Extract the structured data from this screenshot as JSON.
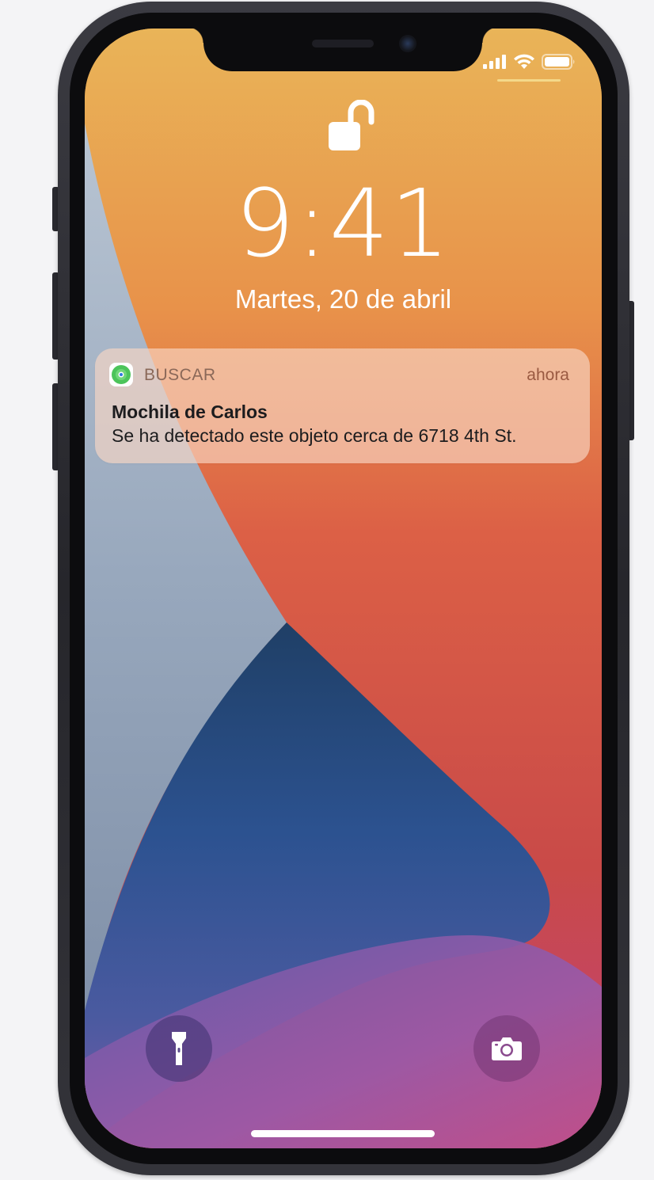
{
  "colors": {
    "wallpaper_orange": "#e8a24a",
    "wallpaper_red": "#d8523f",
    "wallpaper_blue": "#2f4f80",
    "wallpaper_purple": "#8a5aa8",
    "notification_bg": "#f6d4c2",
    "accent_time": "#9a5a42"
  },
  "status_bar": {
    "signal_icon": "cellular-signal-icon",
    "wifi_icon": "wifi-icon",
    "battery_icon": "battery-icon"
  },
  "lock": {
    "icon": "unlocked-padlock-icon"
  },
  "lock_screen": {
    "time": "9:41",
    "date": "Martes, 20 de abril"
  },
  "notification": {
    "app_icon": "find-my-icon",
    "app_name": "BUSCAR",
    "time": "ahora",
    "title": "Mochila de Carlos",
    "body": "Se ha detectado este objeto cerca de 6718 4th St."
  },
  "quick_actions": {
    "flashlight_icon": "flashlight-icon",
    "camera_icon": "camera-icon"
  }
}
